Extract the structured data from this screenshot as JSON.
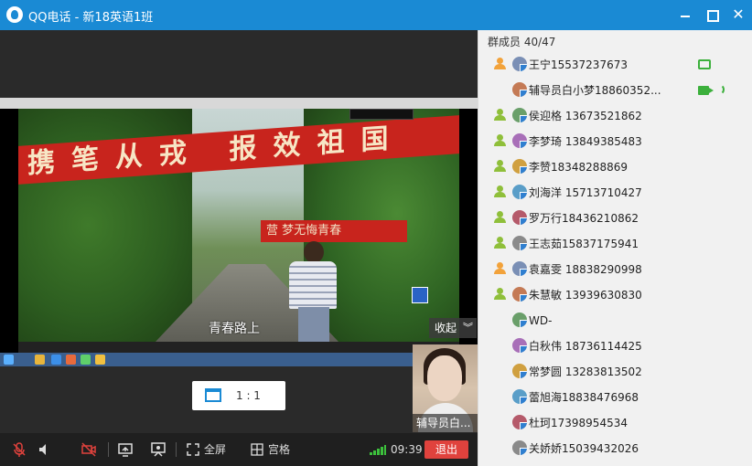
{
  "window": {
    "title": "QQ电话 - 新18英语1班"
  },
  "video": {
    "film_banner_big": "携笔从戎 报效祖国",
    "film_banner_small": "营 梦无悔青春",
    "film_subtitle": "青春路上",
    "collapse_label": "收起",
    "collapse_icon": "double-chevron-down-icon",
    "ratio_label": "1 : 1",
    "pip_name": "辅导员白..."
  },
  "toolbar": {
    "mic_icon": "mic-muted-icon",
    "speaker_icon": "speaker-icon",
    "camera_icon": "camera-off-icon",
    "share_icon": "screen-share-icon",
    "present_icon": "presenter-icon",
    "fullscreen_label": "全屏",
    "grid_label": "宫格",
    "timer": "09:39",
    "exit_label": "退出"
  },
  "members": {
    "header": "群成员 40/47",
    "items": [
      {
        "name": "王宁15537237673",
        "host": "orange",
        "status": "screen-share"
      },
      {
        "name": "辅导员白小梦18860352...",
        "host": "none",
        "status": "camera-speaking"
      },
      {
        "name": "侯迎格 13673521862",
        "host": "green",
        "status": ""
      },
      {
        "name": "李梦琦 13849385483",
        "host": "green",
        "status": ""
      },
      {
        "name": "李赞18348288869",
        "host": "green",
        "status": ""
      },
      {
        "name": "刘海洋 15713710427",
        "host": "green",
        "status": ""
      },
      {
        "name": "罗万行18436210862",
        "host": "green",
        "status": ""
      },
      {
        "name": "王志茹15837175941",
        "host": "green",
        "status": ""
      },
      {
        "name": "袁嘉雯 18838290998",
        "host": "orange",
        "status": ""
      },
      {
        "name": "朱慧敏 13939630830",
        "host": "green",
        "status": ""
      },
      {
        "name": "WD-",
        "host": "none",
        "status": ""
      },
      {
        "name": "白秋伟 18736114425",
        "host": "none",
        "status": ""
      },
      {
        "name": "常梦圆 13283813502",
        "host": "none",
        "status": ""
      },
      {
        "name": "蕾旭海18838476968",
        "host": "none",
        "status": ""
      },
      {
        "name": "杜珂17398954534",
        "host": "none",
        "status": ""
      },
      {
        "name": "关娇娇15039432026",
        "host": "none",
        "status": ""
      }
    ]
  },
  "colors": {
    "titlebar": "#1a8ad4",
    "exit": "#e0423d",
    "active_green": "#3cb03c"
  }
}
